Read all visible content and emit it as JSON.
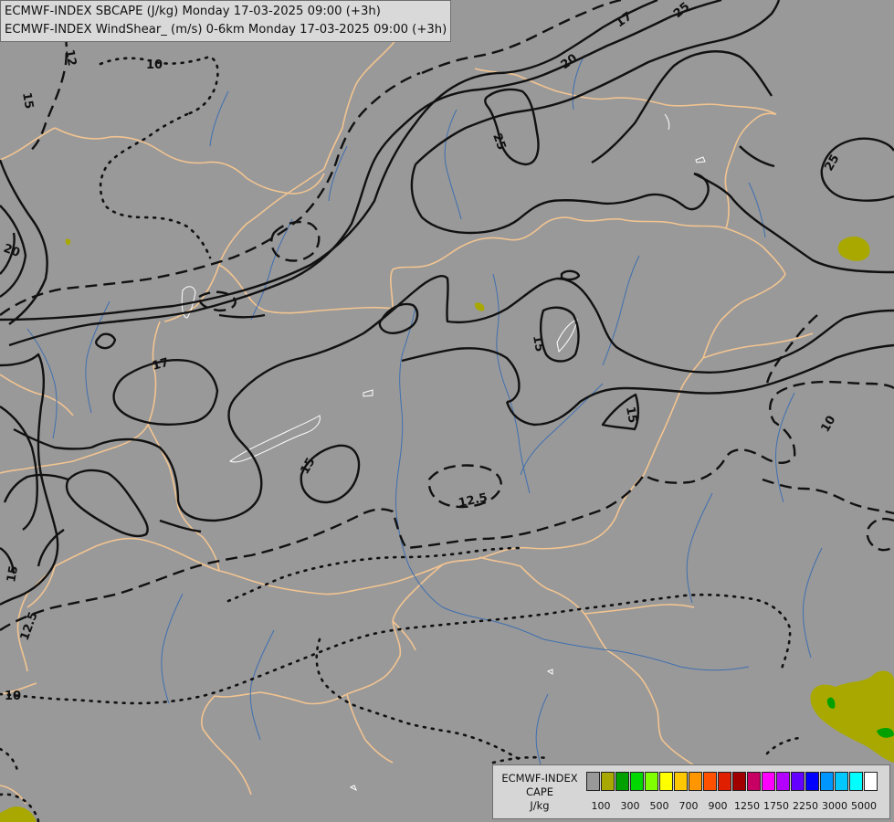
{
  "titles": {
    "line1": "ECMWF-INDEX SBCAPE (J/kg) Monday 17-03-2025 09:00 (+3h)",
    "line2": "ECMWF-INDEX WindShear_ (m/s) 0-6km Monday 17-03-2025 09:00 (+3h)"
  },
  "contour_labels": [
    "10",
    "12",
    "15",
    "20",
    "17",
    "25",
    "20",
    "17",
    "15",
    "15",
    "15",
    "12.5",
    "10",
    "15",
    "12.5",
    "10"
  ],
  "legend": {
    "line1": "ECMWF-INDEX",
    "line2": "CAPE",
    "unit": "J/kg",
    "ticks": [
      "100",
      "300",
      "500",
      "700",
      "900",
      "1250",
      "1750",
      "2250",
      "3000",
      "5000"
    ],
    "colors": [
      "#999999",
      "#a8a800",
      "#00a000",
      "#00d800",
      "#80ff00",
      "#ffff00",
      "#ffc800",
      "#ff9600",
      "#ff5000",
      "#e01e00",
      "#a00000",
      "#c80064",
      "#ff00ff",
      "#b400ff",
      "#6400ff",
      "#0000ff",
      "#0096ff",
      "#00c8ff",
      "#00ffff",
      "#ffffff"
    ]
  },
  "colors": {
    "background": "#999999",
    "borders": "#f2c491",
    "rivers": "#3f6fb0",
    "contours": "#111111",
    "cape_low": "#a8a800",
    "cape_mid": "#00a000"
  }
}
